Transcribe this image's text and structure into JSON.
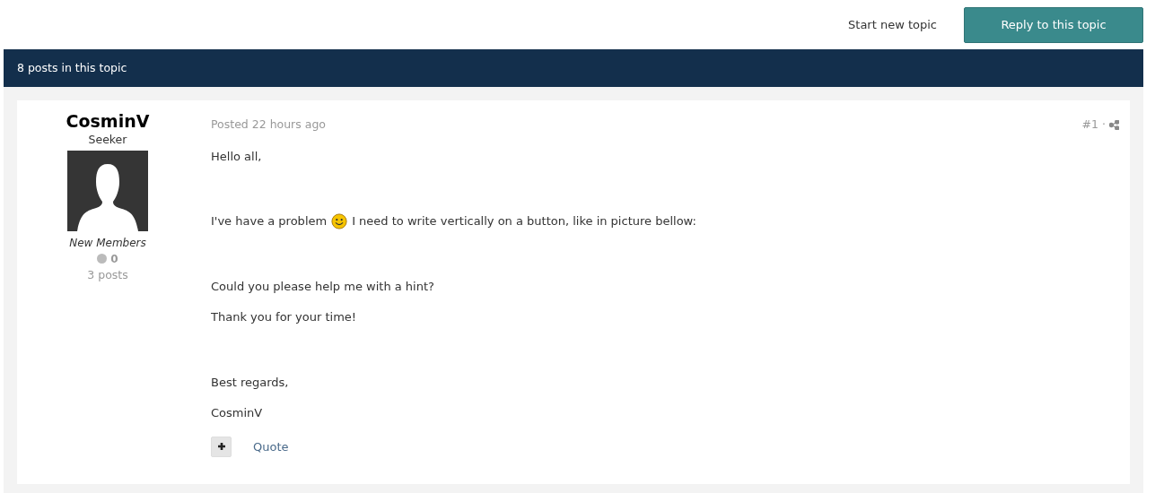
{
  "actions": [
    {
      "label": "Start new topic",
      "kind": "link"
    },
    {
      "label": "Reply to this topic",
      "kind": "primary"
    }
  ],
  "topic_header": {
    "title": "8 posts in this topic"
  },
  "post": {
    "author": {
      "name": "CosminV",
      "rank": "Seeker",
      "group": "New Members",
      "reputation": "0",
      "post_count": "3 posts"
    },
    "posted": "Posted 22 hours ago",
    "number": "#1",
    "separator": "·",
    "paragraphs": [
      {
        "kind": "text",
        "segments": [
          {
            "kind": "text",
            "text": "Hello all,"
          }
        ]
      },
      {
        "kind": "blank"
      },
      {
        "kind": "text",
        "segments": [
          {
            "kind": "text",
            "text": "I've have a problem"
          },
          {
            "kind": "emoji"
          },
          {
            "kind": "text",
            "text": "I need to write vertically on a button, like in picture bellow:"
          }
        ]
      },
      {
        "kind": "blank"
      },
      {
        "kind": "text",
        "segments": [
          {
            "kind": "text",
            "text": "Could you please help me with a hint?"
          }
        ]
      },
      {
        "kind": "text",
        "segments": [
          {
            "kind": "text",
            "text": "Thank you for your time!"
          }
        ]
      },
      {
        "kind": "blank"
      },
      {
        "kind": "text",
        "segments": [
          {
            "kind": "text",
            "text": "Best regards,"
          }
        ]
      },
      {
        "kind": "text",
        "segments": [
          {
            "kind": "text",
            "text": "CosminV"
          }
        ]
      }
    ],
    "quote_label": "Quote"
  }
}
